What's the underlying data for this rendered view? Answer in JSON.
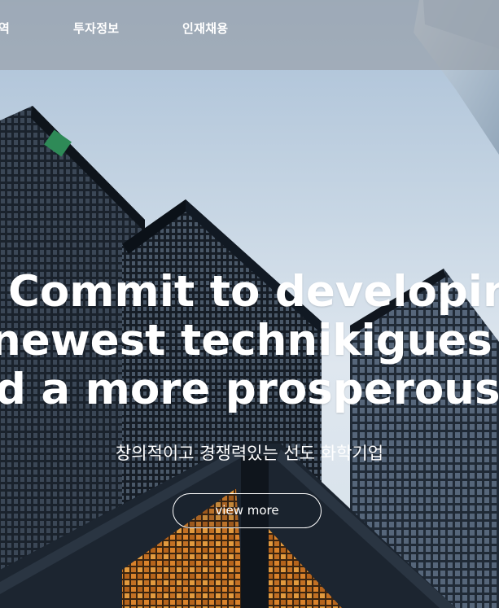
{
  "nav": {
    "items": [
      {
        "label": "역"
      },
      {
        "label": "투자정보"
      },
      {
        "label": "인재채용"
      }
    ]
  },
  "hero": {
    "headline_lines": [
      "Commit to developing",
      "newest technikigues a",
      "d a more prosperous fu"
    ],
    "subtitle": "창의적이고 경쟁력있는 선도 화학기업",
    "button_label": "view more"
  },
  "colors": {
    "nav_overlay": "#969ca4",
    "text": "#ffffff",
    "sky": "#c7d6e4",
    "building_dark": "#1c2530"
  }
}
